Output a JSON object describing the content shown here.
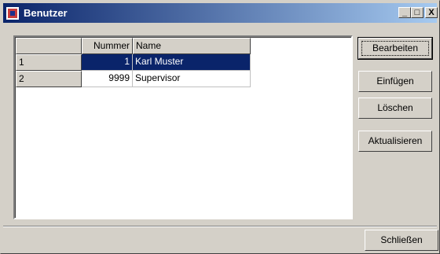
{
  "window": {
    "title": "Benutzer"
  },
  "titlebar_buttons": {
    "minimize": "_",
    "maximize": "□",
    "close": "X"
  },
  "grid": {
    "columns": [
      "",
      "Nummer",
      "Name"
    ],
    "rows": [
      {
        "index": "1",
        "nummer": "1",
        "name": "Karl Muster",
        "selected": true
      },
      {
        "index": "2",
        "nummer": "9999",
        "name": "Supervisor",
        "selected": false
      }
    ]
  },
  "buttons": {
    "bearbeiten": "Bearbeiten",
    "einfuegen": "Einfügen",
    "loeschen": "Löschen",
    "aktualisieren": "Aktualisieren",
    "schliessen": "Schließen"
  },
  "colors": {
    "titlebar_start": "#0a246a",
    "titlebar_end": "#a6caf0",
    "selection": "#0a246a",
    "face": "#d4d0c8"
  }
}
